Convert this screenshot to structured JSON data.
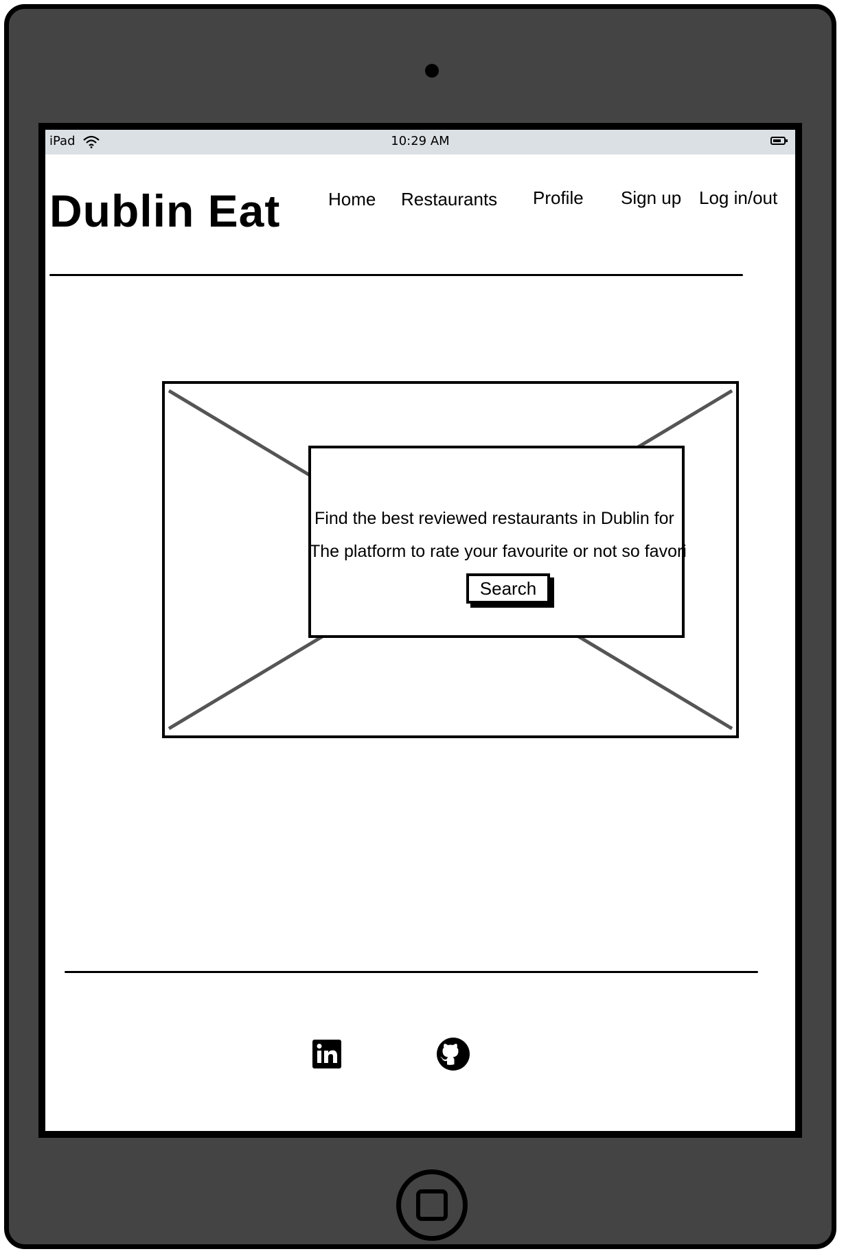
{
  "device": {
    "status_bar": {
      "carrier": "iPad",
      "time": "10:29 AM"
    }
  },
  "header": {
    "brand": "Dublin Eat",
    "nav": {
      "home": "Home",
      "restaurants": "Restaurants",
      "profile": "Profile",
      "signup": "Sign up",
      "login": "Log in/out"
    }
  },
  "hero": {
    "line1": "Find the best reviewed restaurants in Dublin for",
    "line2": "The platform to rate your favourite or not so favori",
    "search_label": "Search"
  },
  "footer": {
    "links": [
      {
        "icon": "linkedin-icon"
      },
      {
        "icon": "github-icon"
      }
    ]
  },
  "colors": {
    "frame": "#444444",
    "status_bar": "#dbe0e4",
    "placeholder_cross": "#555555"
  }
}
